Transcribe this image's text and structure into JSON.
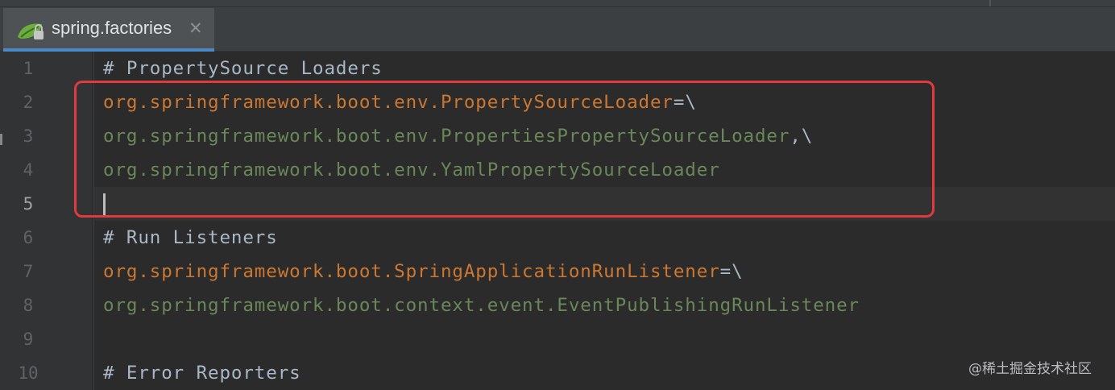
{
  "editor": {
    "tab": {
      "icon": "spring-leaf-file-icon",
      "label": "spring.factories",
      "close_glyph": "✕"
    },
    "current_line": 5,
    "lines": [
      {
        "number": "1",
        "parts": [
          {
            "type": "comment",
            "text": "# PropertySource Loaders"
          }
        ]
      },
      {
        "number": "2",
        "parts": [
          {
            "type": "key",
            "text": "org.springframework.boot.env.PropertySourceLoader"
          },
          {
            "type": "sep",
            "text": "=\\"
          }
        ]
      },
      {
        "number": "3",
        "parts": [
          {
            "type": "val",
            "text": "org.springframework.boot.env.PropertiesPropertySourceLoader"
          },
          {
            "type": "sep",
            "text": ",\\"
          }
        ]
      },
      {
        "number": "4",
        "parts": [
          {
            "type": "val",
            "text": "org.springframework.boot.env.YamlPropertySourceLoader"
          }
        ]
      },
      {
        "number": "5",
        "parts": []
      },
      {
        "number": "6",
        "parts": [
          {
            "type": "comment",
            "text": "# Run Listeners"
          }
        ]
      },
      {
        "number": "7",
        "parts": [
          {
            "type": "key",
            "text": "org.springframework.boot.SpringApplicationRunListener"
          },
          {
            "type": "sep",
            "text": "=\\"
          }
        ]
      },
      {
        "number": "8",
        "parts": [
          {
            "type": "val",
            "text": "org.springframework.boot.context.event.EventPublishingRunListener"
          }
        ]
      },
      {
        "number": "9",
        "parts": []
      },
      {
        "number": "10",
        "parts": [
          {
            "type": "comment",
            "text": "# Error Reporters"
          }
        ]
      }
    ]
  },
  "watermark": "@稀土掘金技术社区",
  "colors": {
    "comment": "#a9b7c6",
    "key": "#cc7832",
    "value": "#6a8759",
    "highlight_border": "#e0393e",
    "tab_accent": "#4a88c7"
  }
}
